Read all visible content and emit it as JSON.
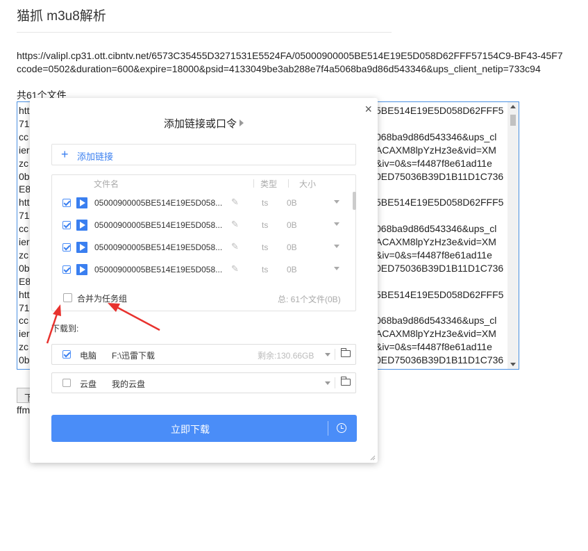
{
  "page": {
    "title": "猫抓 m3u8解析",
    "url_line1": "https://valipl.cp31.ott.cibntv.net/6573C35455D3271531E5524FA/05000900005BE514E19E5D058D62FFF57154C9-BF43-45F7",
    "url_line2": "ccode=0502&duration=600&expire=18000&psid=4133049be3ab288e7f4a5068ba9d86d543346&ups_client_netip=733c94",
    "file_count": "共61个文件",
    "textarea": {
      "left_lines": [
        "htt",
        "71",
        "cc",
        "ier",
        "zc",
        "0b",
        "E8",
        "htt",
        "71",
        "cc",
        "ier",
        "zc",
        "0b",
        "E8",
        "htt",
        "71",
        "cc",
        "ier",
        "zc",
        "0b"
      ],
      "right_lines": [
        "5BE514E19E5D058D62FFF5",
        "",
        "068ba9d86d543346&ups_cl",
        "ACAXM8lpYzHz3e&vid=XM",
        "&iv=0&s=f4487f8e61ad11e",
        "0ED75036B39D1B11D1C736",
        "",
        "5BE514E19E5D058D62FFF5",
        "",
        "068ba9d86d543346&ups_cl",
        "ACAXM8lpYzHz3e&vid=XM",
        "&iv=0&s=f4487f8e61ad11e",
        "0ED75036B39D1B11D1C736",
        "",
        "5BE514E19E5D058D62FFF5",
        "",
        "068ba9d86d543346&ups_cl",
        "ACAXM8lpYzHz3e&vid=XM",
        "&iv=0&s=f4487f8e61ad11e",
        "0ED75036B39D1B11D1C736"
      ]
    },
    "download_button_label": "下",
    "ffm_text": "ffm"
  },
  "dialog": {
    "title": "添加链接或口令",
    "close_icon": "×",
    "add_link_label": "添加链接",
    "headers": {
      "name": "文件名",
      "type": "类型",
      "size": "大小"
    },
    "files": [
      {
        "name": "05000900005BE514E19E5D058...",
        "type": "ts",
        "size": "0B",
        "checked": true
      },
      {
        "name": "05000900005BE514E19E5D058...",
        "type": "ts",
        "size": "0B",
        "checked": true
      },
      {
        "name": "05000900005BE514E19E5D058...",
        "type": "ts",
        "size": "0B",
        "checked": true
      },
      {
        "name": "05000900005BE514E19E5D058...",
        "type": "ts",
        "size": "0B",
        "checked": true
      }
    ],
    "merge_label": "合并为任务组",
    "total": "总:  61个文件(0B)",
    "download_to": "下载到:",
    "destinations": [
      {
        "name": "电脑",
        "path": "F:\\迅雷下载",
        "free": "剩余:130.66GB",
        "checked": true
      },
      {
        "name": "云盘",
        "path": "我的云盘",
        "free": "",
        "checked": false
      }
    ],
    "download_now": "立即下载"
  },
  "colors": {
    "accent": "#4a8df8",
    "arrow": "#e8322e"
  }
}
